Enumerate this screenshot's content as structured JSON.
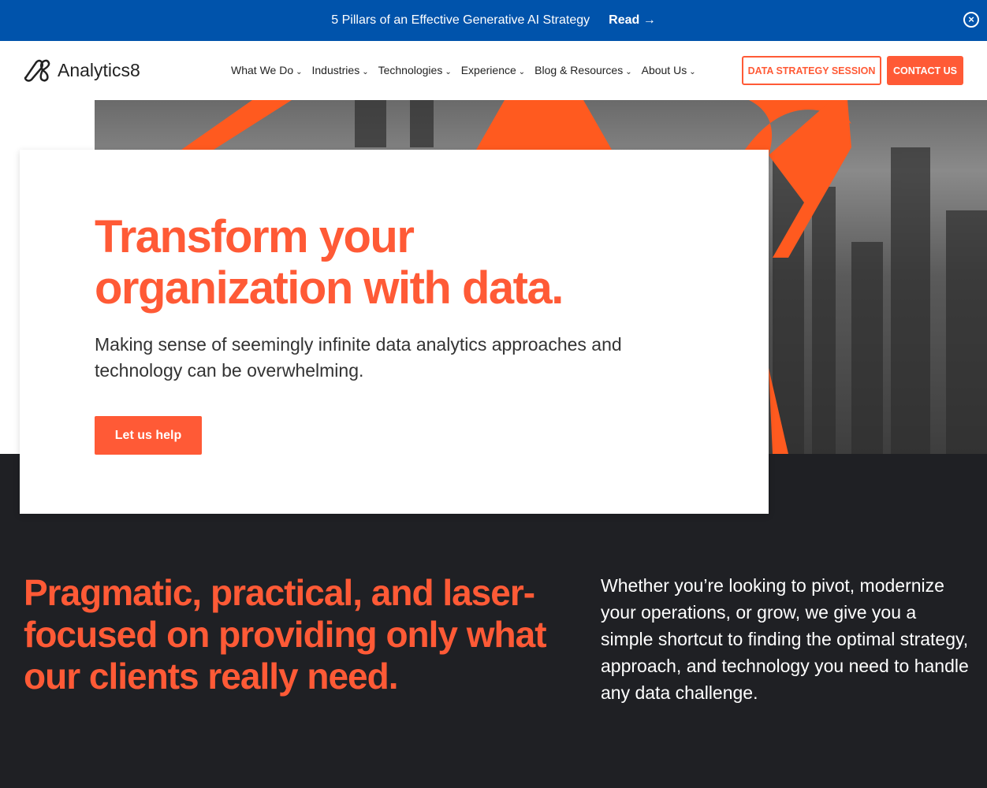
{
  "banner": {
    "text": "5 Pillars of an Effective Generative AI Strategy",
    "read": "Read →",
    "close": "×"
  },
  "nav": {
    "logo": "Analytics8",
    "items": [
      "What We Do",
      "Industries",
      "Technologies",
      "Experience",
      "Blog & Resources",
      "About Us"
    ],
    "chevron": "⌄",
    "strategy": "DATA STRATEGY SESSION",
    "contact": "CONTACT US"
  },
  "hero": {
    "title": "Transform your organization with data.",
    "subtitle": "Making sense of seemingly infinite data analytics approaches and technology can be overwhelming.",
    "cta": "Let us help"
  },
  "section": {
    "heading": "Pragmatic, practical, and laser-focused on providing only what our clients really need.",
    "body": "Whether you’re looking to pivot, modernize your operations, or grow, we give you a simple shortcut to finding the optimal strategy, approach, and technology you need to handle any data challenge."
  },
  "colors": {
    "brand_blue": "#0053ab",
    "accent": "#ff5a36",
    "dark": "#1f2024"
  }
}
